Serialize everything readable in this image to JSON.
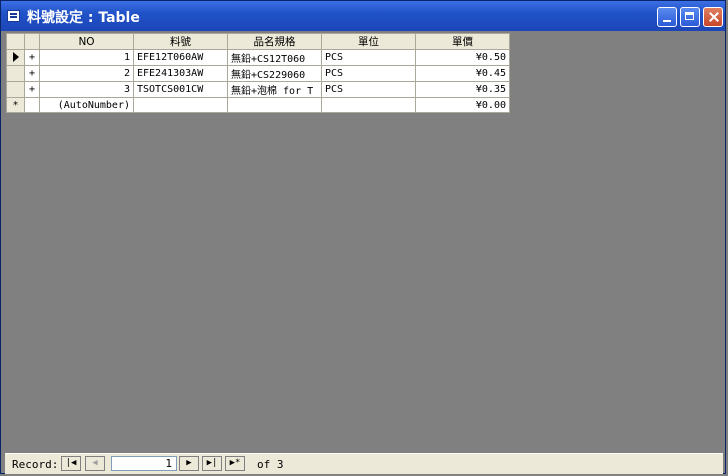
{
  "window": {
    "title": "料號設定 : Table"
  },
  "table": {
    "columns": [
      "NO",
      "料號",
      "品名規格",
      "單位",
      "單價"
    ],
    "rows": [
      {
        "selector": "arrow",
        "expand": "+",
        "no": "1",
        "code": "EFE12T060AW",
        "spec": "無鉛+CS12T060",
        "unit": "PCS",
        "price": "¥0.50"
      },
      {
        "selector": "",
        "expand": "+",
        "no": "2",
        "code": "EFE241303AW",
        "spec": "無鉛+CS229060",
        "unit": "PCS",
        "price": "¥0.45"
      },
      {
        "selector": "",
        "expand": "+",
        "no": "3",
        "code": "TSOTCS001CW",
        "spec": "無鉛+泡棉 for T",
        "unit": "PCS",
        "price": "¥0.35"
      }
    ],
    "new_row": {
      "selector": "*",
      "no": "(AutoNumber)",
      "price": "¥0.00"
    }
  },
  "status": {
    "record_label": "Record:",
    "current_record": "1",
    "of_text": "of  3"
  },
  "icons": [
    "first-record-icon",
    "previous-record-icon",
    "next-record-icon",
    "last-record-icon",
    "new-record-icon"
  ]
}
